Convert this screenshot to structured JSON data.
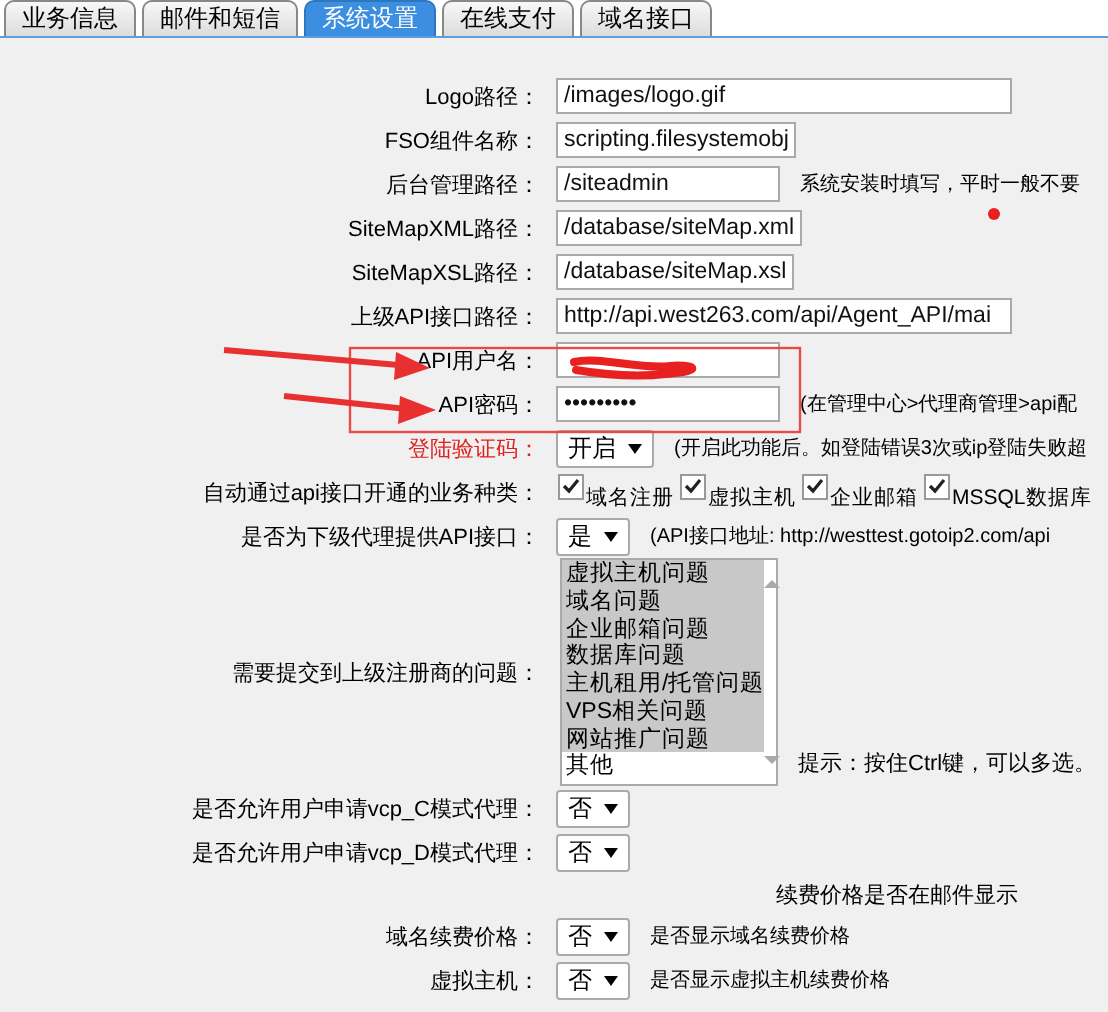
{
  "tabs": [
    {
      "label": "业务信息",
      "selected": false
    },
    {
      "label": "邮件和短信",
      "selected": false
    },
    {
      "label": "系统设置",
      "selected": true
    },
    {
      "label": "在线支付",
      "selected": false
    },
    {
      "label": "域名接口",
      "selected": false
    }
  ],
  "rows": [
    {
      "kind": "text",
      "label": "Logo路径：",
      "highlighted": false,
      "value": "/images/logo.gif",
      "wide": true
    },
    {
      "kind": "text",
      "label": "FSO组件名称：",
      "highlighted": false,
      "value": "scripting.filesystemobj",
      "wide": false
    },
    {
      "kind": "text",
      "label": "后台管理路径：",
      "highlighted": false,
      "value": "/siteadmin",
      "wide": false,
      "note": "系统安装时填写，平时一般不要"
    },
    {
      "kind": "text",
      "label": "SiteMapXML路径：",
      "highlighted": false,
      "value": "/database/siteMap.xml",
      "wide": false
    },
    {
      "kind": "text",
      "label": "SiteMapXSL路径：",
      "highlighted": false,
      "value": "/database/siteMap.xsl",
      "wide": false
    },
    {
      "kind": "text",
      "label": "上级API接口路径：",
      "highlighted": false,
      "value": "http://api.west263.com/api/Agent_API/mai",
      "wide": true
    },
    {
      "kind": "redacted",
      "label": "API用户名：",
      "highlighted": false,
      "wide": false
    },
    {
      "kind": "text",
      "label": "API密码：",
      "highlighted": false,
      "value": "•••••••••",
      "wide": false,
      "note": "(在管理中心>代理商管理>api配"
    },
    {
      "kind": "select",
      "label": "登陆验证码：",
      "highlighted": true,
      "value": "开启",
      "note": "(开启此功能后。如登陆错误3次或ip登陆失败超"
    },
    {
      "kind": "checkboxes",
      "label": "自动通过api接口开通的业务种类：",
      "highlighted": false,
      "options": [
        {
          "label": "域名注册",
          "checked": true
        },
        {
          "label": "虚拟主机",
          "checked": true
        },
        {
          "label": "企业邮箱",
          "checked": true
        },
        {
          "label": "MSSQL数据库",
          "checked": true
        }
      ]
    },
    {
      "kind": "select",
      "label": "是否为下级代理提供API接口：",
      "highlighted": false,
      "value": "是",
      "note": "(API接口地址: http://westtest.gotoip2.com/api"
    },
    {
      "kind": "listbox",
      "label": "需要提交到上级注册商的问题：",
      "highlighted": false,
      "options": [
        {
          "label": "虚拟主机问题",
          "selected": true
        },
        {
          "label": "域名问题",
          "selected": true
        },
        {
          "label": "企业邮箱问题",
          "selected": true
        },
        {
          "label": "数据库问题",
          "selected": true
        },
        {
          "label": "主机租用/托管问题",
          "selected": true
        },
        {
          "label": "VPS相关问题",
          "selected": true
        },
        {
          "label": "网站推广问题",
          "selected": true
        },
        {
          "label": "其他",
          "selected": false
        }
      ],
      "note": "提示：按住Ctrl键，可以多选。"
    },
    {
      "kind": "select",
      "label": "是否允许用户申请vcp_C模式代理：",
      "highlighted": false,
      "value": "否"
    },
    {
      "kind": "select",
      "label": "是否允许用户申请vcp_D模式代理：",
      "highlighted": false,
      "value": "否"
    },
    {
      "kind": "heading",
      "text": "续费价格是否在邮件显示"
    },
    {
      "kind": "select",
      "label": "域名续费价格：",
      "highlighted": false,
      "value": "否",
      "note": "是否显示域名续费价格"
    },
    {
      "kind": "select",
      "label": "虚拟主机：",
      "highlighted": false,
      "value": "否",
      "note": "是否显示虚拟主机续费价格"
    }
  ]
}
